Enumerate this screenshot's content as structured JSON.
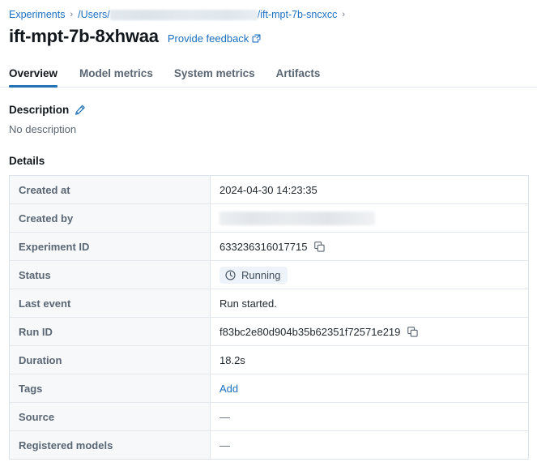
{
  "breadcrumb": {
    "root_label": "Experiments",
    "separator": "›",
    "path_prefix": "/Users/",
    "path_redacted": true,
    "path_suffix": "/ift-mpt-7b-sncxcc",
    "trailing_separator": "›"
  },
  "header": {
    "title": "ift-mpt-7b-8xhwaa",
    "feedback_label": "Provide feedback",
    "feedback_icon": "external-link-icon"
  },
  "tabs": [
    {
      "label": "Overview",
      "active": true
    },
    {
      "label": "Model metrics",
      "active": false
    },
    {
      "label": "System metrics",
      "active": false
    },
    {
      "label": "Artifacts",
      "active": false
    }
  ],
  "description": {
    "title": "Description",
    "edit_icon": "pencil-icon",
    "body": "No description"
  },
  "details": {
    "title": "Details",
    "rows": [
      {
        "label": "Created at",
        "value": "2024-04-30 14:23:35",
        "type": "text"
      },
      {
        "label": "Created by",
        "value": "",
        "type": "redacted"
      },
      {
        "label": "Experiment ID",
        "value": "633236316017715",
        "type": "copyable"
      },
      {
        "label": "Status",
        "value": "Running",
        "type": "status"
      },
      {
        "label": "Last event",
        "value": "Run started.",
        "type": "text"
      },
      {
        "label": "Run ID",
        "value": "f83bc2e80d904b35b62351f72571e219",
        "type": "copyable"
      },
      {
        "label": "Duration",
        "value": "18.2s",
        "type": "text"
      },
      {
        "label": "Tags",
        "value": "Add",
        "type": "link"
      },
      {
        "label": "Source",
        "value": "—",
        "type": "text"
      },
      {
        "label": "Registered models",
        "value": "—",
        "type": "text"
      }
    ]
  },
  "colors": {
    "accent_blue": "#2272b4",
    "link_blue": "#1b6fc0",
    "label_gray": "#5a6673",
    "border": "#dce3ea",
    "row_label_bg": "#f6f8fa",
    "status_pill_bg": "#eef3f9"
  },
  "icons": {
    "copy": "copy-icon",
    "clock": "clock-icon",
    "pencil": "pencil-icon",
    "external_link": "external-link-icon",
    "chevron_right": "chevron-right-icon"
  }
}
